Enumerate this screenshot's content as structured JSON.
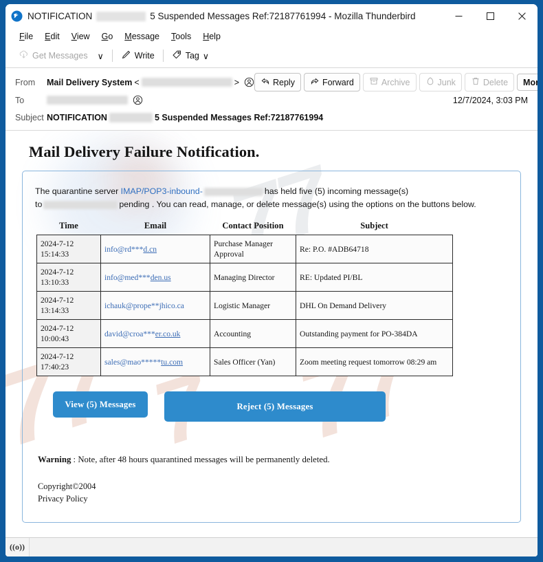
{
  "window": {
    "app_icon": "thunderbird-icon",
    "title_prefix": "NOTIFICATION",
    "title_suffix": "5 Suspended Messages Ref:72187761994 - Mozilla Thunderbird",
    "minimize_label": "—",
    "maximize_label": "☐",
    "close_label": "✕",
    "frame_color": "#0f5b9e"
  },
  "menubar": {
    "items": [
      {
        "pre": "",
        "key": "F",
        "post": "ile"
      },
      {
        "pre": "",
        "key": "E",
        "post": "dit"
      },
      {
        "pre": "",
        "key": "V",
        "post": "iew"
      },
      {
        "pre": "",
        "key": "G",
        "post": "o"
      },
      {
        "pre": "",
        "key": "M",
        "post": "essage"
      },
      {
        "pre": "",
        "key": "T",
        "post": "ools"
      },
      {
        "pre": "",
        "key": "H",
        "post": "elp"
      }
    ]
  },
  "toolbar": {
    "get_messages": "Get Messages",
    "get_messages_caret": "∨",
    "write": "Write",
    "tag": "Tag",
    "tag_caret": "∨"
  },
  "message_header": {
    "from_label": "From",
    "from_name": "Mail Delivery System",
    "from_bracket_open": "<",
    "from_bracket_close": ">",
    "to_label": "To",
    "subject_label": "Subject",
    "subject_bold_prefix": "NOTIFICATION",
    "subject_bold_suffix": "5 Suspended Messages Ref:72187761994",
    "date": "12/7/2024, 3:03 PM",
    "actions": [
      {
        "label": "Reply",
        "icon": "reply-icon",
        "disabled": false
      },
      {
        "label": "Forward",
        "icon": "forward-icon",
        "disabled": false
      },
      {
        "label": "Archive",
        "icon": "archive-icon",
        "disabled": true
      },
      {
        "label": "Junk",
        "icon": "junk-icon",
        "disabled": true
      },
      {
        "label": "Delete",
        "icon": "trash-icon",
        "disabled": true
      }
    ],
    "more_label": "More",
    "more_caret": "∨"
  },
  "mail": {
    "title": "Mail Delivery Failure Notification.",
    "intro": {
      "part1": "The quarantine server ",
      "server_link": "IMAP/POP3-inbound-",
      "part2": "has held five (5) incoming message(s)",
      "part3": "to",
      "part4": "pending . You can read, manage, or delete message(s) using the options on the buttons below."
    },
    "table": {
      "headers": [
        "Time",
        "Email",
        "Contact Position",
        "Subject"
      ],
      "rows": [
        {
          "date": "2024-7-12",
          "time": "15:14:33",
          "email_plain": "info@rd***",
          "email_link": "d.cn",
          "position": "Purchase Manager Approval",
          "subject": "Re: P.O. #ADB64718"
        },
        {
          "date": "2024-7-12",
          "time": "13:10:33",
          "email_plain": "info@med***",
          "email_link": "den.us",
          "position": "Managing Director",
          "subject": "RE: Updated PI/BL"
        },
        {
          "date": "2024-7-12",
          "time": "13:14:33",
          "email_plain": "ichauk@prope**jhico.ca",
          "email_link": "",
          "position": "Logistic Manager",
          "subject": "DHL On Demand Delivery"
        },
        {
          "date": "2024-7-12",
          "time": "10:00:43",
          "email_plain": "david@croa***",
          "email_link": "er.co.uk",
          "position": "Accounting",
          "subject": "Outstanding payment for PO-384DA"
        },
        {
          "date": "2024-7-12",
          "time": "17:40:23",
          "email_plain": "sales@mao*****",
          "email_link": "tu.com",
          "position": "Sales Officer (Yan)",
          "subject": "Zoom meeting request tomorrow  08:29 am"
        }
      ]
    },
    "buttons": {
      "view": "View (5) Messages",
      "reject": "Reject (5) Messages",
      "color": "#2e8bcc"
    },
    "warning_label": "Warning",
    "warning_text": " : Note, after 48 hours quarantined messages will be permanently deleted.",
    "copyright": "Copyright©2004",
    "privacy": "Privacy Policy"
  },
  "statusbar": {
    "icon": "signal-icon",
    "icon_glyph": "((o))"
  }
}
